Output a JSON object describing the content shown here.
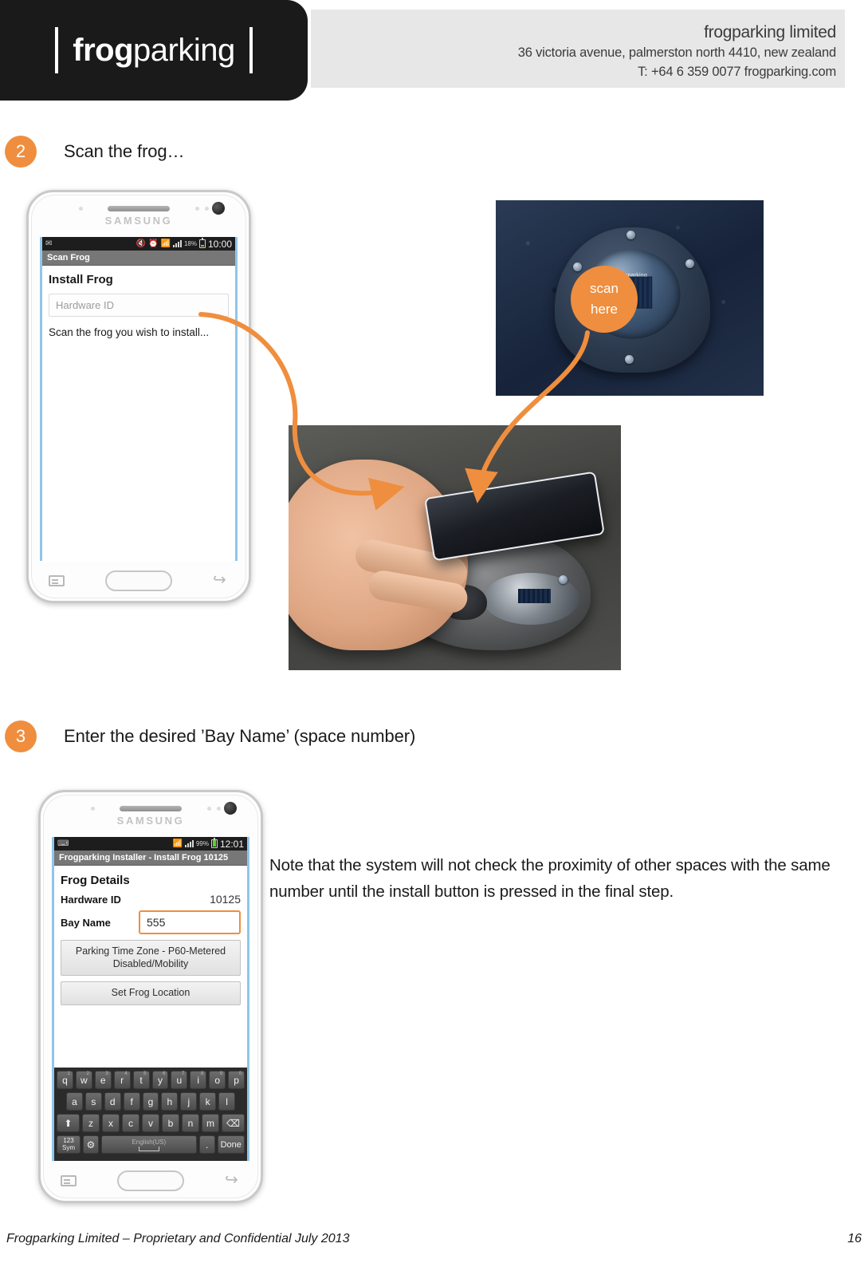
{
  "header": {
    "logo_bold": "frog",
    "logo_regular": "parking",
    "company_name": "frogparking limited",
    "company_address": "36 victoria avenue, palmerston north 4410, new zealand",
    "company_tel": "T: +64 6 359 0077  frogparking.com"
  },
  "steps": [
    {
      "number": "2",
      "text": "Scan the frog…"
    },
    {
      "number": "3",
      "text": "Enter the desired ’Bay Name’ (space number)"
    }
  ],
  "note": "Note that the system will not check the proximity of other spaces with the same number until the install button is pressed in the final step.",
  "phone_scan": {
    "brand": "SAMSUNG",
    "status_bar": {
      "left_icons": [
        "envelope-icon"
      ],
      "right_icons": [
        "mute-icon",
        "alarm-icon",
        "wifi-icon",
        "signal-icon"
      ],
      "battery_percent": "18%",
      "clock": "10:00"
    },
    "app_bar_title": "Scan Frog",
    "heading": "Install Frog",
    "hardware_id_placeholder": "Hardware ID",
    "hint": "Scan the frog you wish to install..."
  },
  "phone_details": {
    "brand": "SAMSUNG",
    "status_bar": {
      "left_icons": [
        "keyboard-icon"
      ],
      "right_icons": [
        "wifi-icon",
        "signal-icon"
      ],
      "battery_percent": "99%",
      "clock": "12:01"
    },
    "app_bar_title": "Frogparking Installer - Install Frog 10125",
    "heading": "Frog Details",
    "fields": [
      {
        "label": "Hardware ID",
        "value": "10125"
      },
      {
        "label": "Bay Name",
        "value": "555"
      }
    ],
    "buttons": [
      "Parking Time Zone - P60-Metered Disabled/Mobility",
      "Set Frog Location"
    ],
    "keyboard": {
      "row1": [
        {
          "key": "q",
          "num": "1"
        },
        {
          "key": "w",
          "num": "2"
        },
        {
          "key": "e",
          "num": "3"
        },
        {
          "key": "r",
          "num": "4"
        },
        {
          "key": "t",
          "num": "5"
        },
        {
          "key": "y",
          "num": "6"
        },
        {
          "key": "u",
          "num": "7"
        },
        {
          "key": "i",
          "num": "8"
        },
        {
          "key": "o",
          "num": "9"
        },
        {
          "key": "p",
          "num": "0"
        }
      ],
      "row2": [
        "a",
        "s",
        "d",
        "f",
        "g",
        "h",
        "j",
        "k",
        "l"
      ],
      "row3": [
        "⬆",
        "z",
        "x",
        "c",
        "v",
        "b",
        "n",
        "m",
        "⌫"
      ],
      "sym_label_top": "123",
      "sym_label_bottom": "Sym",
      "space_label": "English(US)",
      "dot_label": ".",
      "done_label": "Done"
    }
  },
  "photo_sensor": {
    "callout_line1": "scan",
    "callout_line2": "here",
    "device_label": "frogparking"
  },
  "colors": {
    "accent_orange": "#ef8e3e",
    "header_band": "#e7e7e7",
    "logo_black": "#1a1a1a"
  },
  "footer": {
    "left": "Frogparking Limited – Proprietary and Confidential July 2013",
    "page_number": "16"
  }
}
